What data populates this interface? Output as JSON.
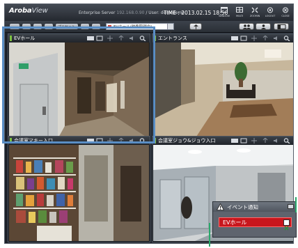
{
  "app": {
    "logo_main": "Aroba",
    "logo_light": "View",
    "server": "Enterprise Server",
    "server_addr": "192.168.0.90",
    "user": "/ User: demodemo",
    "time": "TIME : 2013.02.15 18:56"
  },
  "header_buttons": [
    "WINDOW",
    "MULTI",
    "ZOOMIN",
    "LOGOUT",
    "CLOSE"
  ],
  "toolbar": {
    "preset_label": "プリセット",
    "selected_camera": "EVホール(映像取得中)"
  },
  "panes": [
    {
      "title": "EVホール"
    },
    {
      "title": "エントランス"
    },
    {
      "title": "会議室マキー入口"
    },
    {
      "title": "会議室ジョウ&ジョウ入口"
    }
  ],
  "event_panel": {
    "title": "イベント通知",
    "item": "EVホール"
  },
  "colors": {
    "accent_blue": "#5a8ec5",
    "camera_indicator": "#7dc242",
    "event_red": "#c8161d",
    "callout_green": "#28a86a"
  }
}
